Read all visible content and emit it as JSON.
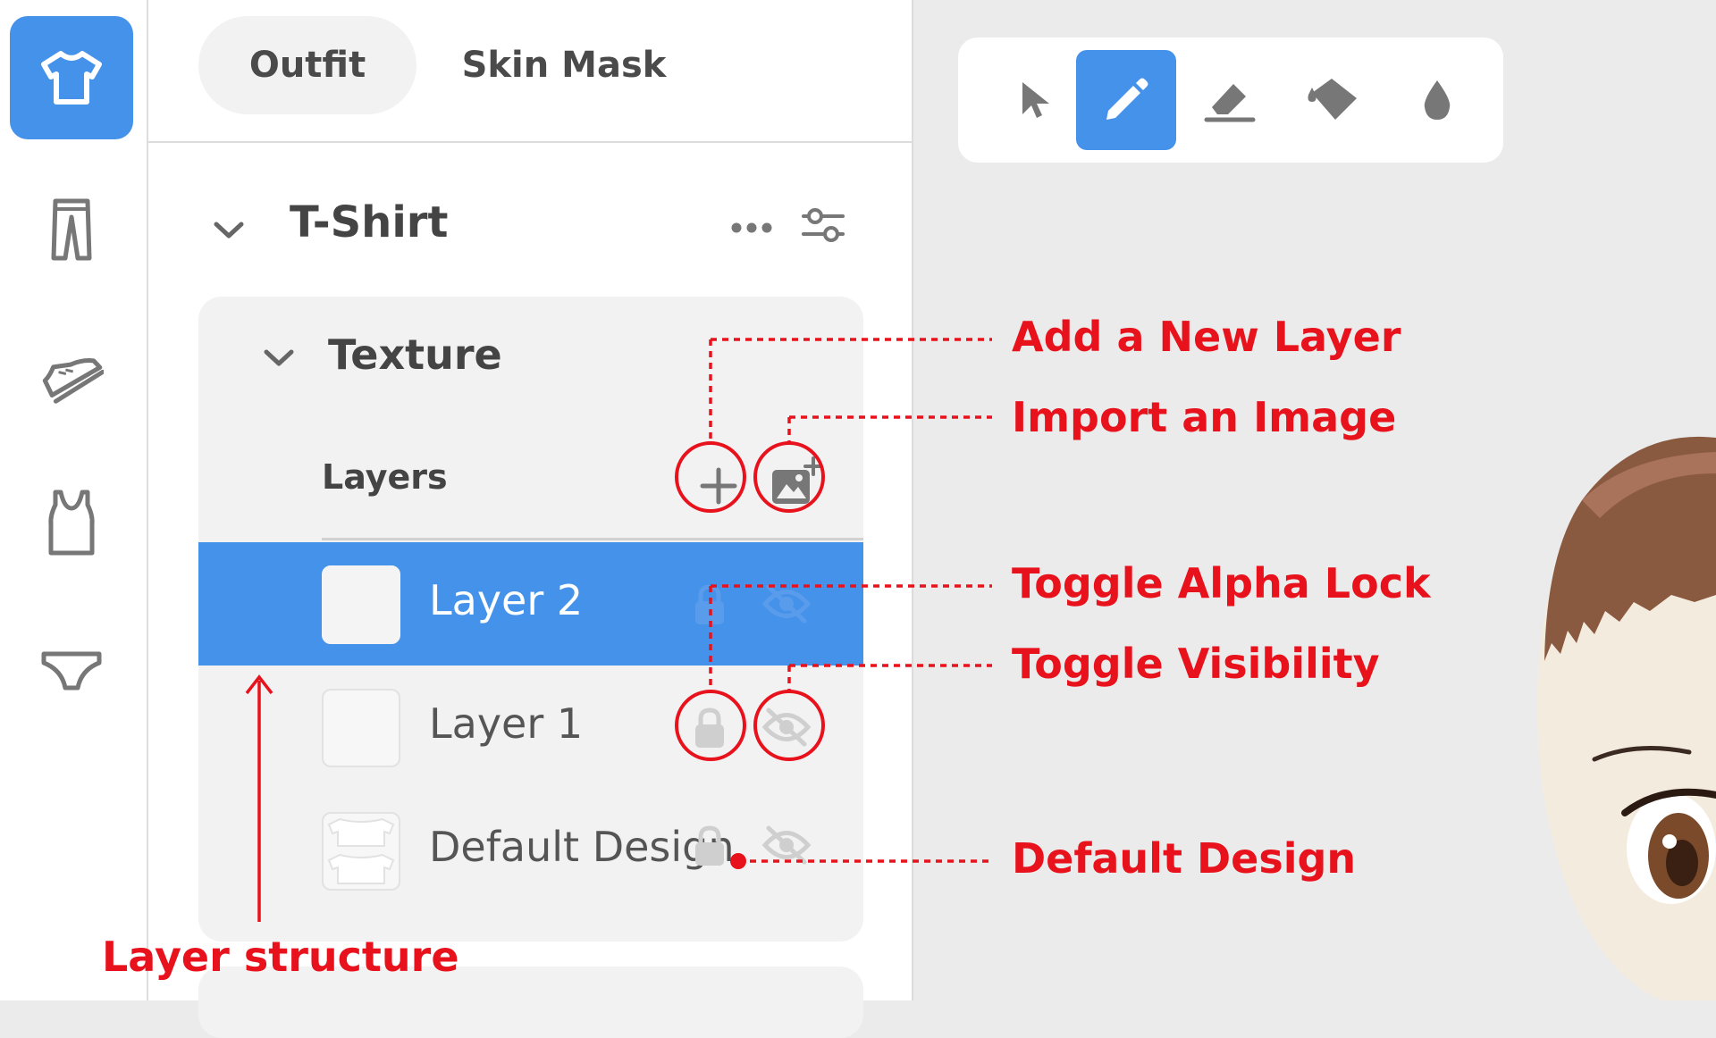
{
  "tabs": {
    "outfit": "Outfit",
    "skin_mask": "Skin Mask"
  },
  "rail": {
    "items": [
      {
        "icon": "tshirt-icon",
        "active": true
      },
      {
        "icon": "pants-icon",
        "active": false
      },
      {
        "icon": "sneaker-icon",
        "active": false
      },
      {
        "icon": "tank-top-icon",
        "active": false
      },
      {
        "icon": "underwear-icon",
        "active": false
      }
    ]
  },
  "garment": {
    "title": "T-Shirt",
    "texture": {
      "title": "Texture",
      "layers_label": "Layers",
      "layers": [
        {
          "name": "Layer 2",
          "selected": true
        },
        {
          "name": "Layer 1",
          "selected": false
        },
        {
          "name": "Default Design",
          "selected": false
        }
      ]
    }
  },
  "toolbar": {
    "tools": [
      "select-arrow-icon",
      "pencil-icon",
      "eraser-icon",
      "fill-bucket-icon",
      "color-dropper-icon"
    ],
    "active_tool": "pencil-icon"
  },
  "annotations": {
    "add_layer": "Add a New Layer",
    "import_image": "Import an Image",
    "alpha_lock": "Toggle Alpha Lock",
    "visibility": "Toggle Visibility",
    "default_design": "Default Design",
    "layer_structure": "Layer structure",
    "color": "#e8121c"
  },
  "colors": {
    "accent": "#4592ea",
    "background": "#ebebeb",
    "panel": "#ffffff",
    "card": "#f2f2f2"
  }
}
